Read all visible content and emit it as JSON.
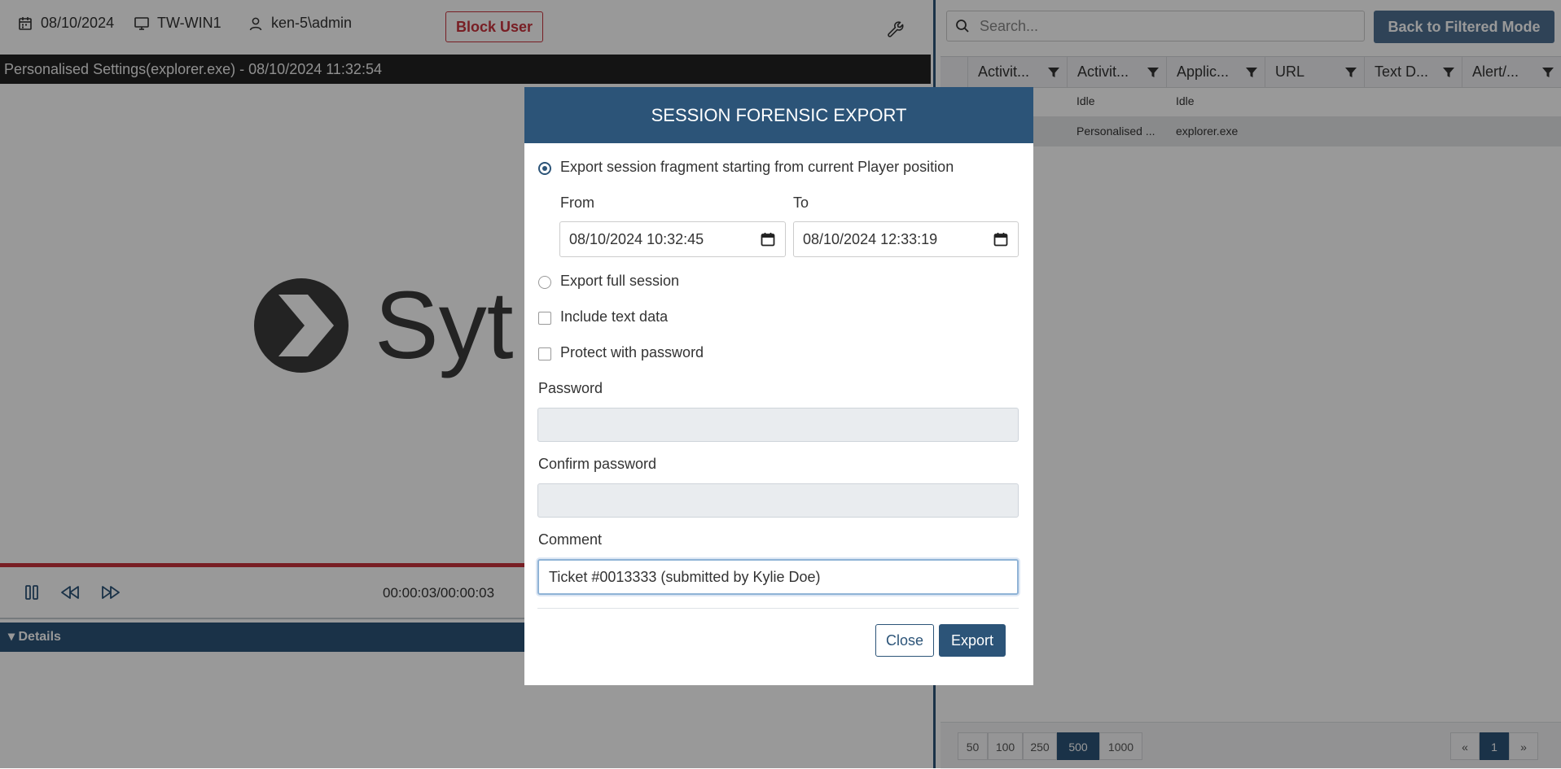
{
  "topbar": {
    "date": "08/10/2024",
    "computer": "TW-WIN1",
    "user": "ken-5\\admin",
    "block_user_label": "Block User"
  },
  "player": {
    "window_title": "Personalised Settings(explorer.exe) - 08/10/2024 11:32:54",
    "logo_text": "Syt",
    "timecode": "00:00:03/00:00:03",
    "progress": 1.0,
    "details_label": "Details"
  },
  "right_panel": {
    "search_placeholder": "Search...",
    "back_button_label": "Back to Filtered Mode",
    "columns": [
      "Activit...",
      "Activit...",
      "Applic...",
      "URL",
      "Text D...",
      "Alert/..."
    ],
    "rows": [
      {
        "activity": "Idle",
        "application": "Idle"
      },
      {
        "activity": "Personalised ...",
        "application": "explorer.exe"
      }
    ],
    "page_sizes": [
      "50",
      "100",
      "250",
      "500",
      "1000"
    ],
    "active_page_size": "500",
    "pager": {
      "prev": "«",
      "current": "1",
      "next": "»"
    }
  },
  "modal": {
    "title": "SESSION FORENSIC EXPORT",
    "option_fragment_label": "Export session fragment starting from current Player position",
    "from_label": "From",
    "to_label": "To",
    "from_value": "08/10/2024 10:32:45",
    "to_value": "08/10/2024 12:33:19",
    "option_full_label": "Export full session",
    "include_text_label": "Include text data",
    "protect_password_label": "Protect with password",
    "password_label": "Password",
    "confirm_password_label": "Confirm password",
    "comment_label": "Comment",
    "comment_value": "Ticket #0013333 (submitted by Kylie Doe)",
    "close_label": "Close",
    "export_label": "Export"
  },
  "colors": {
    "primary": "#2c5478",
    "danger": "#c8323c",
    "back_button": "#4f7191"
  }
}
